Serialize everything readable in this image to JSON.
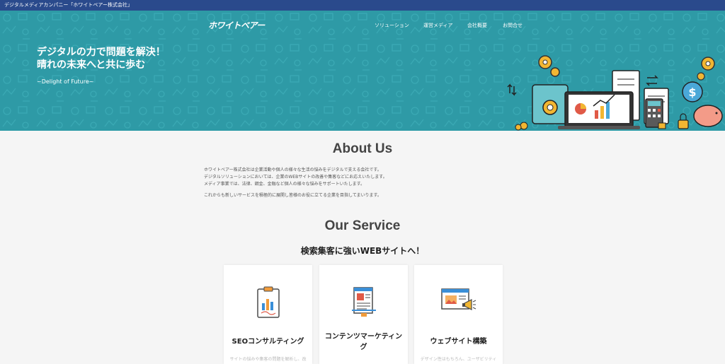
{
  "topbar": {
    "text": "デジタルメディアカンパニー「ホワイトベアー株式会社」"
  },
  "header": {
    "logo": "ホワイトベアー",
    "nav": [
      {
        "label": "ソリューション"
      },
      {
        "label": "運営メディア"
      },
      {
        "label": "会社概要"
      },
      {
        "label": "お問合せ"
      }
    ]
  },
  "hero": {
    "line1": "デジタルの力で問題を解決！",
    "line2": "晴れの未来へと共に歩む",
    "tagline": "~Delight of Future~"
  },
  "about": {
    "title": "About Us",
    "lines": [
      "ホワイトベアー株式会社は企業活動や個人の様々な生活の悩みをデジタルで支える会社です。",
      "デジタルソリューションにおいては、企業のWEBサイトの改善や集客などにお応えいたします。",
      "メディア事業では、法律、鋼金、金融など個人の様々な悩みをサポートいたします。",
      "これからも新しいサービスを積極的に展開し皆様のお役に立てる企業を目指してまいります。"
    ]
  },
  "service": {
    "title": "Our Service",
    "subtitle": "検索集客に強いWEBサイトへ！",
    "cards": [
      {
        "title": "SEOコンサルティング",
        "icon": "clipboard-chart-icon",
        "desc": "サイトの悩みや集客の問題を解析し、改"
      },
      {
        "title": "コンテンツマーケティング",
        "icon": "article-document-icon",
        "desc": ""
      },
      {
        "title": "ウェブサイト構築",
        "icon": "website-megaphone-icon",
        "desc": "デザイン性はもちろん、ユーザビリティ"
      }
    ]
  },
  "colors": {
    "topbar": "#2a4a8c",
    "hero": "#2e9aa6",
    "background": "#f5f5f5"
  }
}
